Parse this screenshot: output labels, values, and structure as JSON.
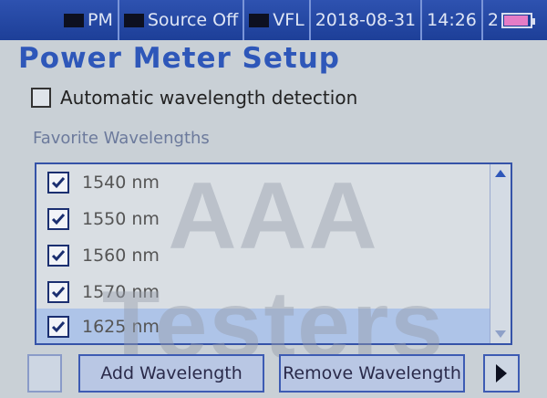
{
  "status_bar": {
    "pm_label": "PM",
    "source_label": "Source Off",
    "vfl_label": "VFL",
    "date": "2018-08-31",
    "time": "14:26",
    "battery_prefix": "2"
  },
  "page_title": "Power Meter Setup",
  "auto_detect": {
    "label": "Automatic wavelength detection",
    "checked": false
  },
  "favorites": {
    "label": "Favorite Wavelengths",
    "items": [
      {
        "label": "1540 nm",
        "checked": true
      },
      {
        "label": "1550 nm",
        "checked": true
      },
      {
        "label": "1560 nm",
        "checked": true
      },
      {
        "label": "1570 nm",
        "checked": true
      },
      {
        "label": "1625 nm",
        "checked": true,
        "selected": true
      }
    ]
  },
  "buttons": {
    "add": "Add Wavelength",
    "remove": "Remove Wavelength"
  },
  "watermark": "AAA Testers",
  "colors": {
    "header_bg": "#1d3f98",
    "title": "#2e57b9",
    "selected_row": "#aec4e8",
    "battery": "#e57cc6"
  }
}
